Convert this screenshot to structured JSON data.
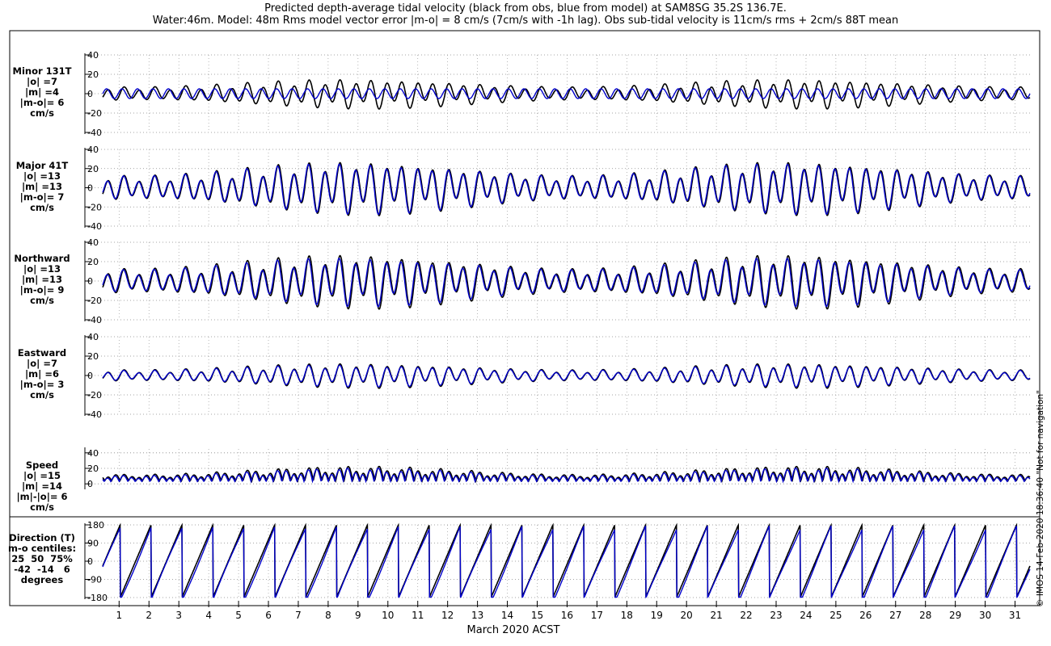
{
  "title": {
    "line1": "Predicted depth-average tidal velocity (black from obs, blue from model) at SAM8SG 35.2S 136.7E.",
    "line2": "Water:46m. Model: 48m  Rms model vector error |m-o| = 8 cm/s (7cm/s with -1h lag). Obs sub-tidal velocity is 11cm/s rms + 2cm/s 88T mean"
  },
  "side_note": "© IMOS 14-Feb-2020 18:36:40  \"Not for navigation\"",
  "colors": {
    "obs": "#000000",
    "model": "#0000cc"
  },
  "chart_data": [
    {
      "type": "line",
      "label_lines": [
        "Minor 131T",
        "|o| =7",
        "|m| =4",
        "|m-o|= 6",
        "cm/s"
      ],
      "yticks": [
        "40",
        "20",
        "0",
        "-20",
        "-40"
      ],
      "ylim": [
        -40,
        40
      ],
      "obs_amp": 12,
      "model_amp": 5,
      "model_phase": 0.8,
      "series": [
        {
          "name": "obs"
        },
        {
          "name": "model"
        }
      ]
    },
    {
      "type": "line",
      "label_lines": [
        "Major 41T",
        "|o| =13",
        "|m| =13",
        "|m-o|= 7",
        "cm/s"
      ],
      "yticks": [
        "40",
        "20",
        "0",
        "-20",
        "-40"
      ],
      "ylim": [
        -40,
        40
      ],
      "obs_amp": 22,
      "model_amp": 21,
      "model_phase": 0.25,
      "series": [
        {
          "name": "obs"
        },
        {
          "name": "model"
        }
      ]
    },
    {
      "type": "line",
      "label_lines": [
        "Northward",
        "|o| =13",
        "|m| =13",
        "|m-o|= 9",
        "cm/s"
      ],
      "yticks": [
        "40",
        "20",
        "0",
        "-20",
        "-40"
      ],
      "ylim": [
        -40,
        40
      ],
      "obs_amp": 22,
      "model_amp": 20,
      "model_phase": 0.35,
      "series": [
        {
          "name": "obs"
        },
        {
          "name": "model"
        }
      ]
    },
    {
      "type": "line",
      "label_lines": [
        "Eastward",
        "|o| =7",
        "|m| =6",
        "|m-o|= 3",
        "cm/s"
      ],
      "yticks": [
        "40",
        "20",
        "0",
        "-20",
        "-40"
      ],
      "ylim": [
        -40,
        40
      ],
      "obs_amp": 10,
      "model_amp": 9,
      "model_phase": 0.15,
      "series": [
        {
          "name": "obs"
        },
        {
          "name": "model"
        }
      ]
    },
    {
      "type": "line",
      "label_lines": [
        "Speed",
        "|o| =15",
        "|m| =14",
        "|m|-|o|= 6",
        "cm/s"
      ],
      "yticks": [
        "40",
        "20",
        "0"
      ],
      "ylim": [
        -5,
        45
      ],
      "obs_amp": 22,
      "model_amp": 22,
      "model_phase": 0.3,
      "series": [
        {
          "name": "obs"
        },
        {
          "name": "model"
        }
      ]
    },
    {
      "type": "line",
      "label_lines": [
        "Direction (T)",
        "m-o centiles:",
        "25  50  75%",
        "-42  -14   6",
        "degrees"
      ],
      "yticks": [
        "180",
        "90",
        "0",
        "-90",
        "-180"
      ],
      "ylim": [
        -180,
        180
      ],
      "series": [
        {
          "name": "obs"
        },
        {
          "name": "model"
        }
      ]
    }
  ],
  "xaxis": {
    "label": "March 2020 ACST",
    "ticks": [
      "1",
      "2",
      "3",
      "4",
      "5",
      "6",
      "7",
      "8",
      "9",
      "10",
      "11",
      "12",
      "13",
      "14",
      "15",
      "16",
      "17",
      "18",
      "19",
      "20",
      "21",
      "22",
      "23",
      "24",
      "25",
      "26",
      "27",
      "28",
      "29",
      "30",
      "31"
    ]
  }
}
